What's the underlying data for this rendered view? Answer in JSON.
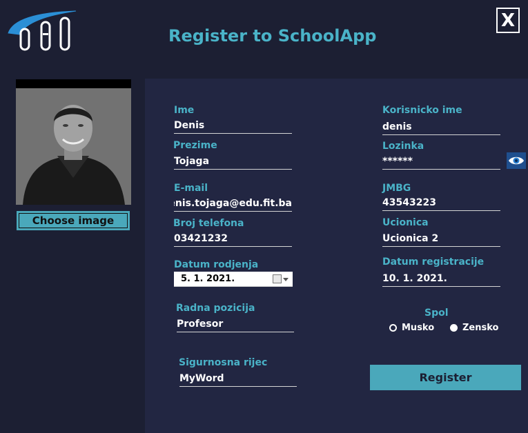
{
  "window": {
    "title": "Register to SchoolApp",
    "close_label": "X"
  },
  "logo": {
    "icon": "fit-logo"
  },
  "photo": {
    "choose_label": "Choose image"
  },
  "form": {
    "ime": {
      "label": "Ime",
      "value": "Denis"
    },
    "prezime": {
      "label": "Prezime",
      "value": "Tojaga"
    },
    "email": {
      "label": "E-mail",
      "value": "denis.tojaga@edu.fit.ba"
    },
    "telefon": {
      "label": "Broj telefona",
      "value": "03421232"
    },
    "datum_rodjenja": {
      "label": "Datum rodjenja",
      "value": "5.   1. 2021."
    },
    "radna_pozicija": {
      "label": "Radna pozicija",
      "value": "Profesor"
    },
    "sigurnosna_rijec": {
      "label": "Sigurnosna rijec",
      "value": "MyWord"
    },
    "korisnicko_ime": {
      "label": "Korisnicko ime",
      "value": "denis"
    },
    "lozinka": {
      "label": "Lozinka",
      "value": "******"
    },
    "jmbg": {
      "label": "JMBG",
      "value": "43543223"
    },
    "ucionica": {
      "label": "Ucionica",
      "value": "Ucionica 2"
    },
    "datum_registracije": {
      "label": "Datum registracije",
      "value": "10. 1. 2021."
    },
    "spol": {
      "label": "Spol",
      "options": [
        "Musko",
        "Zensko"
      ],
      "selected": "Zensko"
    }
  },
  "register_label": "Register",
  "colors": {
    "background": "#1c1f33",
    "panel": "#222642",
    "accent": "#4ab3c8",
    "button": "#4aa8bb"
  }
}
